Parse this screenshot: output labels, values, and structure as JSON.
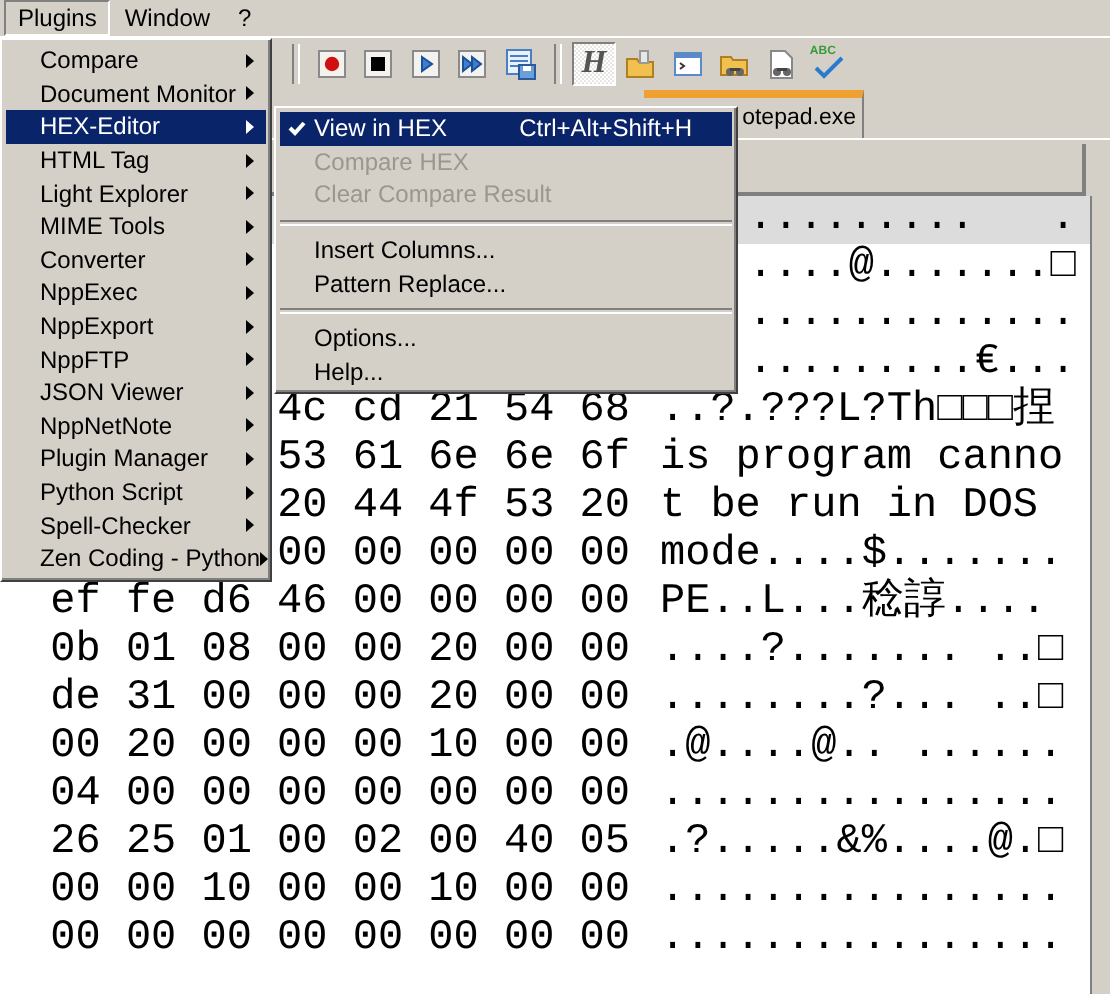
{
  "menubar": [
    {
      "label": "Plugins",
      "selected": true
    },
    {
      "label": "Window",
      "selected": false
    },
    {
      "label": "?",
      "selected": false
    }
  ],
  "toolbar": {
    "groups": [
      {
        "buttons": [
          {
            "pressed": false
          },
          {
            "pressed": false
          },
          {
            "pressed": false
          },
          {
            "pressed": false
          },
          {
            "pressed": false
          }
        ]
      },
      {
        "buttons": [
          {
            "label": "H",
            "pressed": true
          },
          {
            "pressed": false
          },
          {
            "pressed": false
          },
          {
            "pressed": false
          },
          {
            "pressed": false
          },
          {
            "label": "ABC",
            "pressed": false
          }
        ]
      }
    ]
  },
  "tabs": [
    {
      "label": "otepad.exe",
      "selected": true
    }
  ],
  "hex_view": {
    "rows": [
      {
        "ascii": ".........   .",
        "selected": true
      },
      {
        "ascii": "....@.......□",
        "selected": false
      },
      {
        "ascii": ".............",
        "selected": false
      },
      {
        "ascii": ".........€...",
        "selected": false
      },
      {
        "hex": "4c cd 21 54 68",
        "ascii": "..?.???L?Th□□□捏",
        "selected": false
      },
      {
        "hex": "53 61 6e 6e 6f",
        "ascii": "is program canno",
        "selected": false
      },
      {
        "hex": "20 44 4f 53 20",
        "ascii": "t be run in DOS",
        "selected": false
      },
      {
        "hex": "00 00 00 00 00",
        "ascii": "mode....$.......",
        "selected": false
      },
      {
        "hex": "ef fe d6 46 00 00 00 00",
        "ascii": "PE..L...稔諄....",
        "selected": false
      },
      {
        "hex": "0b 01 08 00 00 20 00 00",
        "ascii": "....?....... ..□",
        "selected": false
      },
      {
        "hex": "de 31 00 00 00 20 00 00",
        "ascii": "........?... ..□",
        "selected": false
      },
      {
        "hex": "00 20 00 00 00 10 00 00",
        "ascii": ".@....@.. ......",
        "selected": false
      },
      {
        "hex": "04 00 00 00 00 00 00 00",
        "ascii": "................",
        "selected": false
      },
      {
        "hex": "26 25 01 00 02 00 40 05",
        "ascii": ".?.....&%....@.□",
        "selected": false
      },
      {
        "hex": "00 00 10 00 00 10 00 00",
        "ascii": "................",
        "selected": false
      },
      {
        "hex": "00 00 00 00 00 00 00 00",
        "ascii": "................",
        "selected": false
      }
    ]
  },
  "plugins_menu": {
    "items": [
      {
        "label": "Compare",
        "selected": false
      },
      {
        "label": "Document Monitor",
        "selected": false
      },
      {
        "label": "HEX-Editor",
        "selected": true
      },
      {
        "label": "HTML Tag",
        "selected": false
      },
      {
        "label": "Light Explorer",
        "selected": false
      },
      {
        "label": "MIME Tools",
        "selected": false
      },
      {
        "label": "Converter",
        "selected": false
      },
      {
        "label": "NppExec",
        "selected": false
      },
      {
        "label": "NppExport",
        "selected": false
      },
      {
        "label": "NppFTP",
        "selected": false
      },
      {
        "label": "JSON Viewer",
        "selected": false
      },
      {
        "label": "NppNetNote",
        "selected": false
      },
      {
        "label": "Plugin Manager",
        "selected": false
      },
      {
        "label": "Python Script",
        "selected": false
      },
      {
        "label": "Spell-Checker",
        "selected": false
      },
      {
        "label": "Zen Coding - Python",
        "selected": false
      }
    ]
  },
  "hex_editor_submenu": {
    "items": [
      {
        "kind": "item",
        "label": "View in HEX",
        "shortcut": "Ctrl+Alt+Shift+H",
        "checked": true,
        "disabled": false,
        "selected": true
      },
      {
        "kind": "item",
        "label": "Compare HEX",
        "checked": false,
        "disabled": true,
        "selected": false
      },
      {
        "kind": "item",
        "label": "Clear Compare Result",
        "checked": false,
        "disabled": true,
        "selected": false
      },
      {
        "kind": "separator"
      },
      {
        "kind": "item",
        "label": "Insert Columns...",
        "checked": false,
        "disabled": false,
        "selected": false
      },
      {
        "kind": "item",
        "label": "Pattern Replace...",
        "checked": false,
        "disabled": false,
        "selected": false
      },
      {
        "kind": "separator"
      },
      {
        "kind": "item",
        "label": "Options...",
        "checked": false,
        "disabled": false,
        "selected": false
      },
      {
        "kind": "item",
        "label": "Help...",
        "checked": false,
        "disabled": false,
        "selected": false
      }
    ]
  }
}
